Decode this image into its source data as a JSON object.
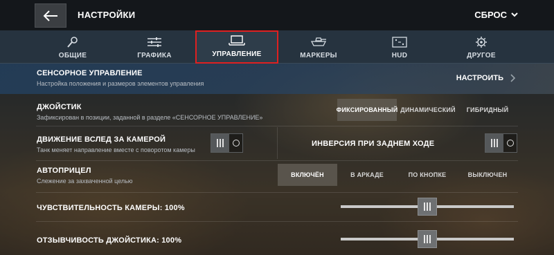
{
  "header": {
    "title": "НАСТРОЙКИ",
    "reset_label": "СБРОС",
    "back_icon": "arrow-left-icon",
    "reset_icon": "chevron-down-icon"
  },
  "tabs": [
    {
      "label": "ОБЩИЕ",
      "icon": "wrench-icon",
      "active": false
    },
    {
      "label": "ГРАФИКА",
      "icon": "sliders-icon",
      "active": false
    },
    {
      "label": "УПРАВЛЕНИЕ",
      "icon": "tablet-icon",
      "active": true
    },
    {
      "label": "МАРКЕРЫ",
      "icon": "tank-icon",
      "active": false
    },
    {
      "label": "HUD",
      "icon": "screen-icon",
      "active": false
    },
    {
      "label": "ДРУГОЕ",
      "icon": "gear-icon",
      "active": false
    }
  ],
  "touch_control": {
    "title": "СЕНСОРНОЕ УПРАВЛЕНИЕ",
    "subtitle": "Настройка положения и размеров элементов управления",
    "action_label": "НАСТРОИТЬ"
  },
  "joystick": {
    "title": "ДЖОЙСТИК",
    "subtitle": "Зафиксирован в позиции, заданной в разделе «СЕНСОРНОЕ УПРАВЛЕНИЕ»",
    "options": [
      "ФИКСИРОВАННЫЙ",
      "ДИНАМИЧЕСКИЙ",
      "ГИБРИДНЫЙ"
    ],
    "selected": "ФИКСИРОВАННЫЙ"
  },
  "camera_follow": {
    "title": "ДВИЖЕНИЕ ВСЛЕД ЗА КАМЕРОЙ",
    "subtitle": "Танк меняет направление вместе с поворотом камеры",
    "enabled": true
  },
  "reverse_inversion": {
    "title": "ИНВЕРСИЯ ПРИ ЗАДНЕМ ХОДЕ",
    "enabled": true
  },
  "autoaim": {
    "title": "АВТОПРИЦЕЛ",
    "subtitle": "Слежение за захваченной целью",
    "options": [
      "ВКЛЮЧЁН",
      "В АРКАДЕ",
      "ПО КНОПКЕ",
      "ВЫКЛЮЧЕН"
    ],
    "selected": "ВКЛЮЧЁН"
  },
  "camera_sensitivity": {
    "label": "ЧУВСТВИТЕЛЬНОСТЬ КАМЕРЫ: 100%",
    "value": 0.5
  },
  "joystick_response": {
    "label": "ОТЗЫВЧИВОСТЬ ДЖОЙСТИКА: 100%",
    "value": 0.5
  },
  "colors": {
    "active_tab_outline": "#e02020",
    "tab_bar": "#26333f",
    "header": "#14171b"
  }
}
